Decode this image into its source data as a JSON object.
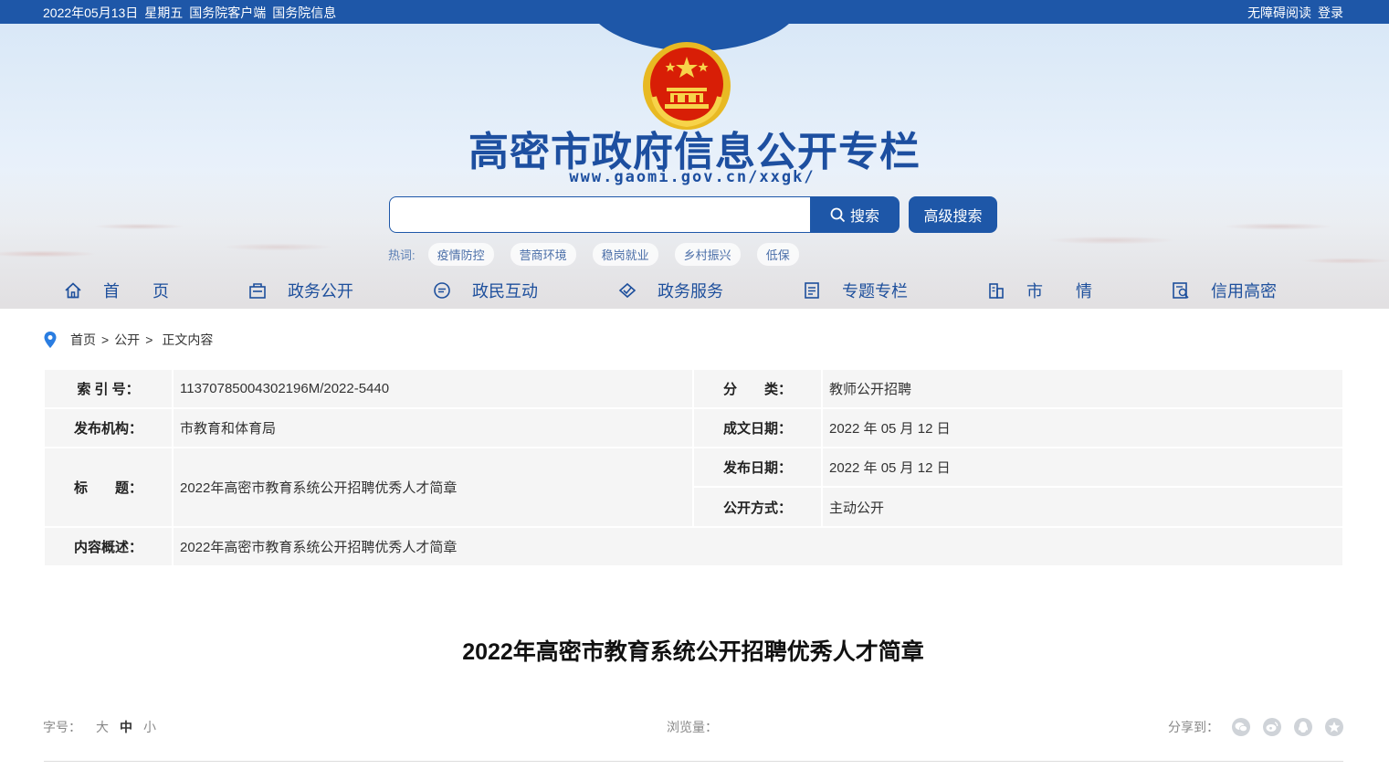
{
  "topbar": {
    "date": "2022年05月13日",
    "weekday": "星期五",
    "client_link": "国务院客户端",
    "info_link": "国务院信息",
    "accessibility": "无障碍阅读",
    "login": "登录"
  },
  "header": {
    "title": "高密市政府信息公开专栏",
    "url": "www.gaomi.gov.cn/xxgk/",
    "search": {
      "placeholder": "",
      "button": "搜索",
      "advanced": "高级搜索"
    },
    "hot_label": "热词:",
    "hot_tags": [
      "疫情防控",
      "营商环境",
      "稳岗就业",
      "乡村振兴",
      "低保"
    ]
  },
  "nav": [
    {
      "label": "首　　页",
      "icon": "home-icon"
    },
    {
      "label": "政务公开",
      "icon": "gov-building-icon"
    },
    {
      "label": "政民互动",
      "icon": "chat-icon"
    },
    {
      "label": "政务服务",
      "icon": "service-icon"
    },
    {
      "label": "专题专栏",
      "icon": "document-icon"
    },
    {
      "label": "市　　情",
      "icon": "city-icon"
    },
    {
      "label": "信用高密",
      "icon": "credit-search-icon"
    }
  ],
  "breadcrumb": {
    "home": "首页",
    "section": "公开",
    "current": "正文内容",
    "sep": ">"
  },
  "meta": {
    "index_key": "索 引 号：",
    "index_val": "11370785004302196M/2022-5440",
    "cat_key": "分　　类：",
    "cat_val": "教师公开招聘",
    "org_key": "发布机构：",
    "org_val": "市教育和体育局",
    "written_key": "成文日期：",
    "written_val": "2022 年 05 月 12 日",
    "title_key": "标　　题：",
    "title_val": "2022年高密市教育系统公开招聘优秀人才简章",
    "pub_key": "发布日期：",
    "pub_val": "2022 年 05 月 12 日",
    "mode_key": "公开方式：",
    "mode_val": "主动公开",
    "summary_key": "内容概述：",
    "summary_val": "2022年高密市教育系统公开招聘优秀人才简章"
  },
  "article": {
    "title": "2022年高密市教育系统公开招聘优秀人才简章"
  },
  "tools": {
    "font_label": "字号：",
    "font_large": "大",
    "font_medium": "中",
    "font_small": "小",
    "views_label": "浏览量：",
    "share_label": "分享到：",
    "share_icons": [
      "wechat-icon",
      "weibo-icon",
      "qq-icon",
      "qzone-icon"
    ]
  }
}
